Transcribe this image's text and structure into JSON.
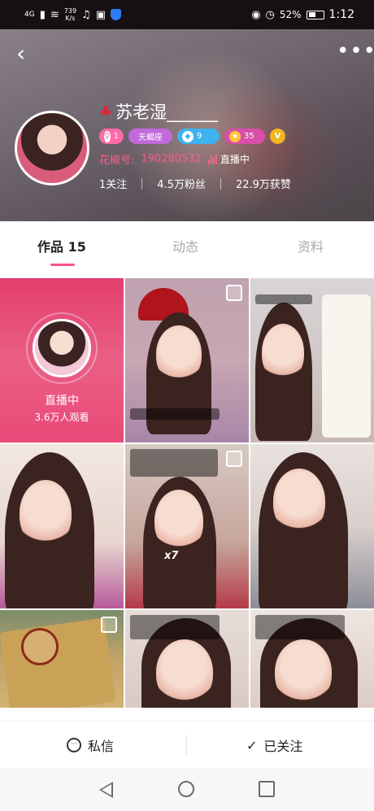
{
  "status_bar": {
    "network": "4G",
    "speed_value": "739",
    "speed_unit": "K/s",
    "battery": "52%",
    "time": "1:12"
  },
  "profile": {
    "name": "苏老湿______",
    "badges": {
      "gender_count": "1",
      "zodiac": "天蝎座",
      "level": "9",
      "star": "35",
      "v": "V"
    },
    "id_label": "花椒号:",
    "id_value": "190280532",
    "live_status": "直播中",
    "stats": {
      "following": "1关注",
      "fans": "4.5万粉丝",
      "likes": "22.9万获赞"
    }
  },
  "tabs": [
    {
      "label": "作品 15",
      "active": true
    },
    {
      "label": "动态",
      "active": false
    },
    {
      "label": "资料",
      "active": false
    }
  ],
  "grid": {
    "live_card": {
      "status": "直播中",
      "viewers": "3.6万人观看"
    },
    "x7_label": "x7"
  },
  "actions": {
    "message": "私信",
    "follow": "已关注"
  },
  "colors": {
    "accent": "#ff4f86",
    "live_pink": "#e23e6e"
  }
}
